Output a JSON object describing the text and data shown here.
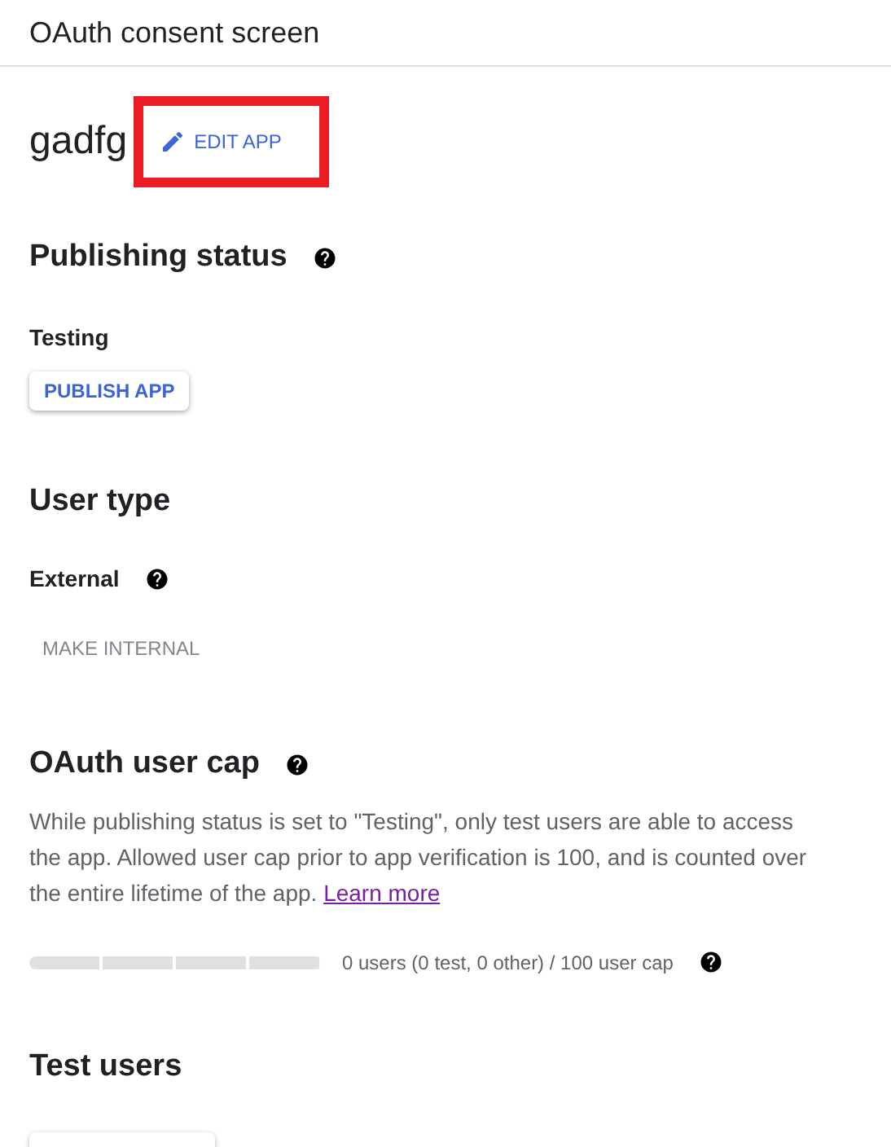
{
  "header": {
    "title": "OAuth consent screen"
  },
  "app": {
    "name": "gadfg",
    "edit_button": "EDIT APP",
    "highlighted": true
  },
  "publishing_status": {
    "heading": "Publishing status",
    "status": "Testing",
    "button": "PUBLISH APP"
  },
  "user_type": {
    "heading": "User type",
    "value": "External",
    "button": "MAKE INTERNAL",
    "button_disabled": true
  },
  "user_cap": {
    "heading": "OAuth user cap",
    "description": "While publishing status is set to \"Testing\", only test users are able to access the app. Allowed user cap prior to app verification is 100, and is counted over the entire lifetime of the app.",
    "link": "Learn more",
    "reading": "0 users (0 test, 0 other) / 100 user cap"
  },
  "test_users": {
    "heading": "Test users"
  }
}
